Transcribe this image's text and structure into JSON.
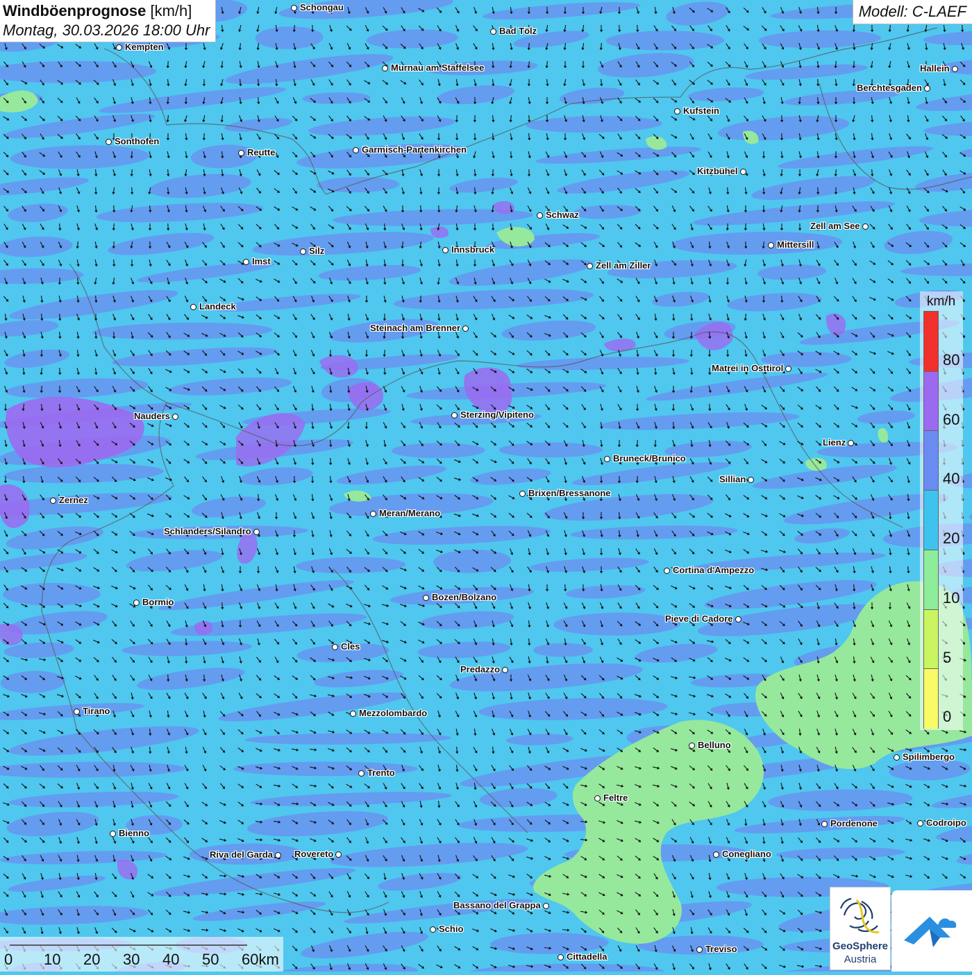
{
  "title": {
    "bold": "Windböenprognose",
    "unit": "[km/h]",
    "datetime": "Montag, 30.03.2026 18:00 Uhr"
  },
  "model": "Modell: C-LAEF",
  "legend": {
    "unit": "km/h",
    "ticks": [
      "80",
      "60",
      "40",
      "20",
      "10",
      "5",
      "0"
    ],
    "colors": [
      "#f0302c",
      "#9b6af0",
      "#6a8bf2",
      "#3ec3ef",
      "#8ded9a",
      "#c9f560",
      "#f8fa66"
    ]
  },
  "scalebar": {
    "labels": [
      "0",
      "10",
      "20",
      "30",
      "40",
      "50",
      "60km"
    ]
  },
  "logos": {
    "geosphere_line1": "GeoSphere",
    "geosphere_line2": "Austria"
  },
  "colors": {
    "base": "#4fc7ef",
    "medium": "#6b8ef0",
    "high": "#9b6af0",
    "low": "#96e89c",
    "arrow": "#111111",
    "border": "#555555"
  },
  "cities": [
    {
      "name": "Schongau"
    },
    {
      "name": "Bad Tölz"
    },
    {
      "name": "Kempten"
    },
    {
      "name": "Murnau am Staffelsee"
    },
    {
      "name": "Hallein"
    },
    {
      "name": "Berchtesgaden"
    },
    {
      "name": "Kufstein"
    },
    {
      "name": "Sonthofen"
    },
    {
      "name": "Reutte"
    },
    {
      "name": "Garmisch-Partenkirchen"
    },
    {
      "name": "Kitzbühel"
    },
    {
      "name": "Schwaz"
    },
    {
      "name": "Zell am See"
    },
    {
      "name": "Innsbruck"
    },
    {
      "name": "Mittersill"
    },
    {
      "name": "Silz"
    },
    {
      "name": "Imst"
    },
    {
      "name": "Zell am Ziller"
    },
    {
      "name": "Landeck"
    },
    {
      "name": "Steinach am Brenner"
    },
    {
      "name": "Matrei in Osttirol"
    },
    {
      "name": "Nauders"
    },
    {
      "name": "Sterzing/Vipiteno"
    },
    {
      "name": "Lienz"
    },
    {
      "name": "Bruneck/Brunico"
    },
    {
      "name": "Sillian"
    },
    {
      "name": "Zernez"
    },
    {
      "name": "Brixen/Bressanone"
    },
    {
      "name": "Meran/Merano"
    },
    {
      "name": "Schlanders/Silandro"
    },
    {
      "name": "Cortina d'Ampezzo"
    },
    {
      "name": "Bozen/Bolzano"
    },
    {
      "name": "Bormio"
    },
    {
      "name": "Pieve di Cadore"
    },
    {
      "name": "Cles"
    },
    {
      "name": "Predazzo"
    },
    {
      "name": "Tirano"
    },
    {
      "name": "Mezzolombardo"
    },
    {
      "name": "Belluno"
    },
    {
      "name": "Spilimbergo"
    },
    {
      "name": "Trento"
    },
    {
      "name": "Feltre"
    },
    {
      "name": "Pordenone"
    },
    {
      "name": "Codroipo"
    },
    {
      "name": "Bienno"
    },
    {
      "name": "Riva del Garda"
    },
    {
      "name": "Rovereto"
    },
    {
      "name": "Conegliano"
    },
    {
      "name": "Bassano del Grappa"
    },
    {
      "name": "Schio"
    },
    {
      "name": "Treviso"
    },
    {
      "name": "Cittadella"
    }
  ]
}
